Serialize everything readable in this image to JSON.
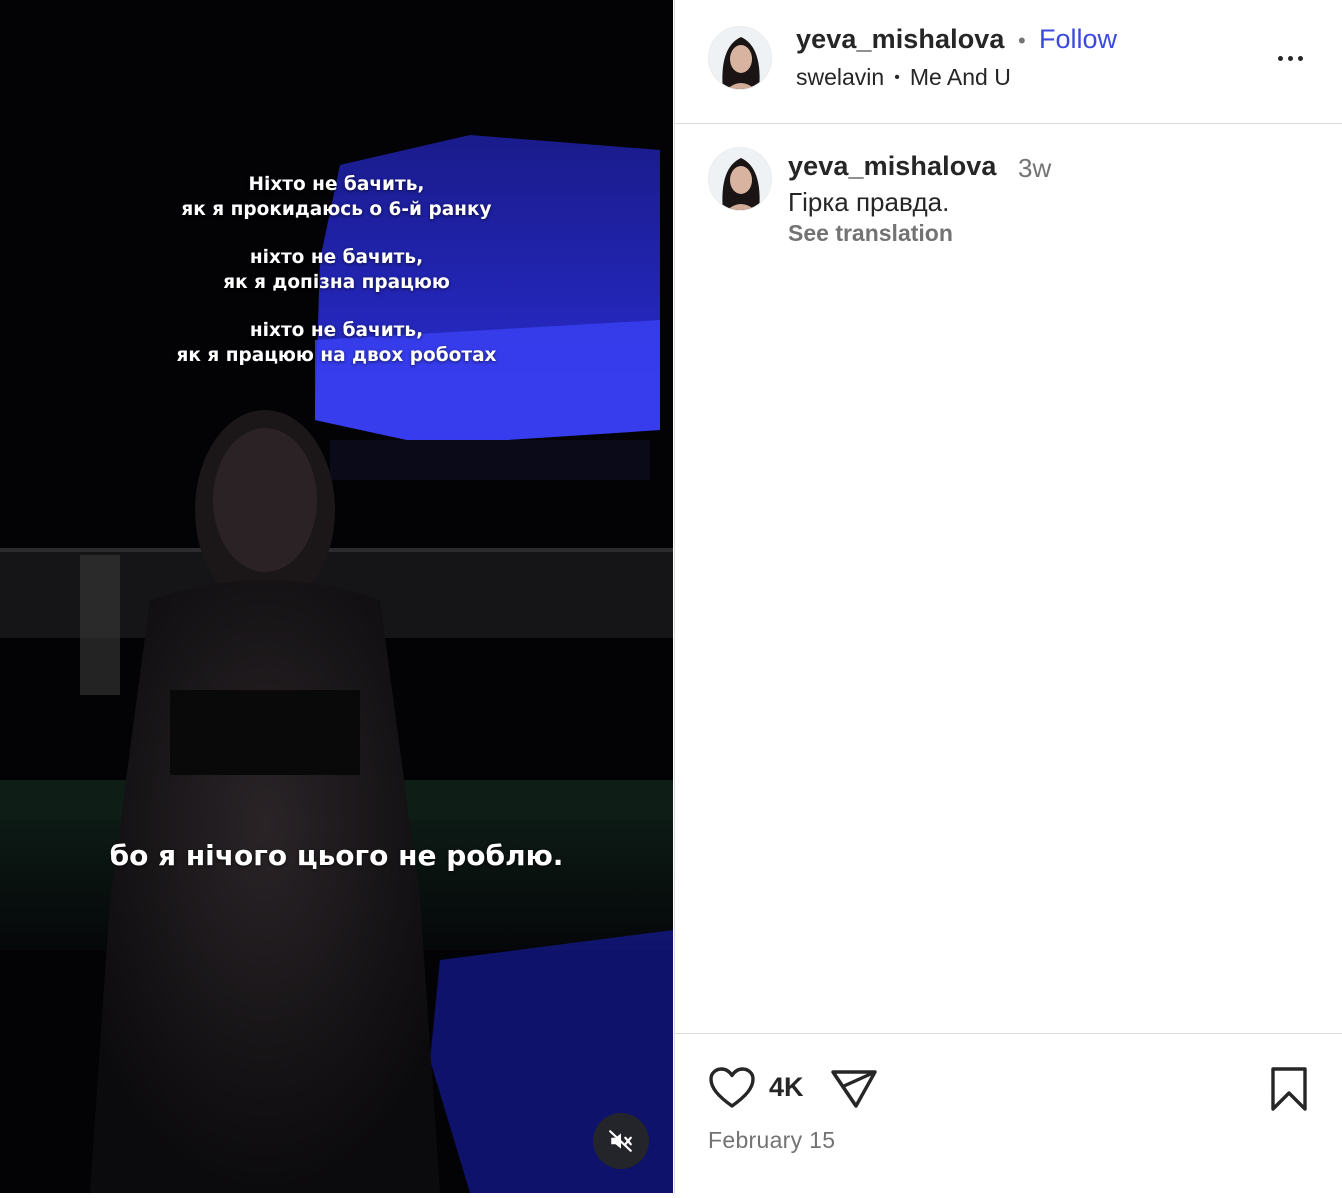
{
  "video": {
    "caption_top": [
      {
        "l1": "Ніхто не бачить,",
        "l2": "як я прокидаюсь о 6-й ранку"
      },
      {
        "l1": "ніхто не бачить,",
        "l2": "як я допізна працюю"
      },
      {
        "l1": "ніхто не бачить,",
        "l2": "як я працюю  на двох роботах"
      }
    ],
    "caption_bottom": "бо я нічого цього не роблю.",
    "mute_icon": "speaker-muted-icon"
  },
  "header": {
    "username": "yeva_mishalova",
    "separator": "•",
    "follow_label": "Follow",
    "audio_artist": "swelavin",
    "audio_sep": "•",
    "audio_track": "Me And U",
    "more_icon": "more-options-icon"
  },
  "comment": {
    "username": "yeva_mishalova",
    "time_ago": "3w",
    "text": "Гірка правда.",
    "see_translation": "See translation"
  },
  "actions": {
    "likes": "4K",
    "date": "February 15",
    "like_icon": "heart-icon",
    "share_icon": "paper-plane-icon",
    "save_icon": "bookmark-icon"
  },
  "colors": {
    "accent": "#3b49df",
    "text": "#262626",
    "muted": "#737373",
    "divider": "#dbdbdb",
    "media_bg": "#030306",
    "neon_blue": "#2a2fe0"
  }
}
